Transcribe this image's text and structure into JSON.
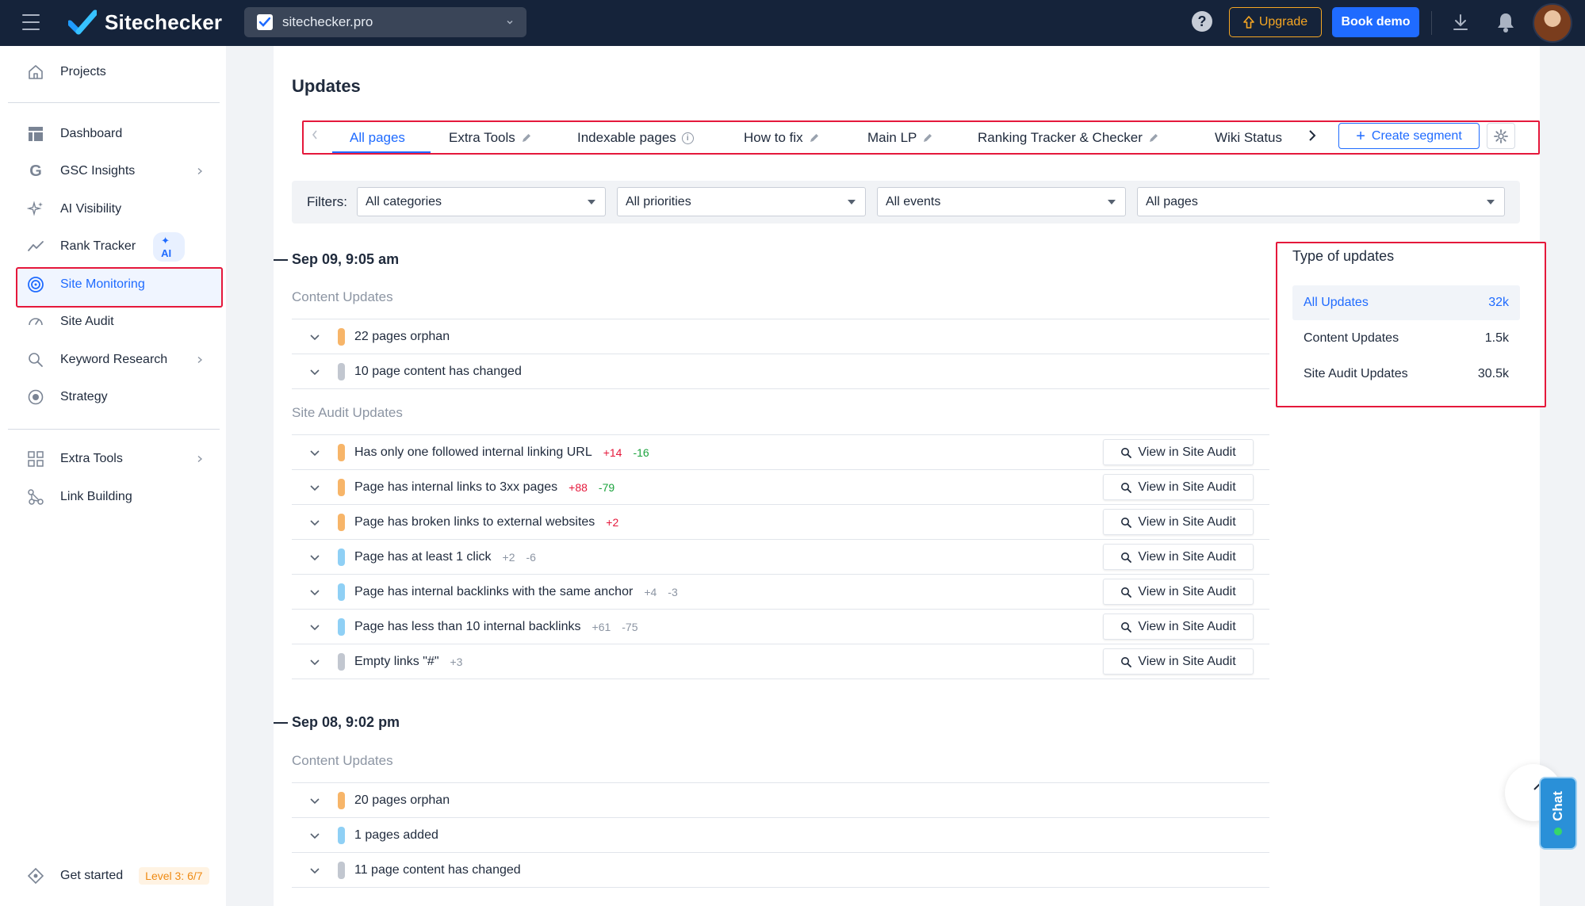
{
  "app": {
    "name": "Sitechecker",
    "site": "sitechecker.pro"
  },
  "topbar": {
    "help": "?",
    "upgrade_label": "Upgrade",
    "book_demo_label": "Book demo"
  },
  "sidebar": {
    "projects": "Projects",
    "items": [
      {
        "label": "Dashboard"
      },
      {
        "label": "GSC Insights"
      },
      {
        "label": "AI Visibility"
      },
      {
        "label": "Rank Tracker",
        "badge": "AI"
      },
      {
        "label": "Site Monitoring"
      },
      {
        "label": "Site Audit"
      },
      {
        "label": "Keyword Research"
      },
      {
        "label": "Strategy"
      },
      {
        "label": "Extra Tools"
      },
      {
        "label": "Link Building"
      }
    ],
    "get_started": "Get started",
    "level": "Level 3: 6/7"
  },
  "page": {
    "title": "Updates"
  },
  "tabs": {
    "items": [
      "All pages",
      "Extra Tools",
      "Indexable pages",
      "How to fix",
      "Main LP",
      "Ranking Tracker & Checker",
      "Wiki Status"
    ],
    "create_segment": "Create segment"
  },
  "filters": {
    "label": "Filters:",
    "categories": "All categories",
    "priorities": "All priorities",
    "events": "All events",
    "pages": "All pages"
  },
  "groups": [
    {
      "date": "Sep 09, 9:05 am",
      "content_label": "Content Updates",
      "content_rows": [
        {
          "text": "22 pages orphan",
          "color": "#f7b569"
        },
        {
          "text": "10 page content has changed",
          "color": "#c2c7d0"
        }
      ],
      "audit_label": "Site Audit Updates",
      "audit_rows": [
        {
          "text": "Has only one followed internal linking URL",
          "color": "#f7b569",
          "plus": "+14",
          "minus": "-16",
          "plus_class": "red",
          "minus_class": "green"
        },
        {
          "text": "Page has internal links to 3xx pages",
          "color": "#f7b569",
          "plus": "+88",
          "minus": "-79",
          "plus_class": "red",
          "minus_class": "green"
        },
        {
          "text": "Page has broken links to external websites",
          "color": "#f7b569",
          "plus": "+2",
          "minus": "",
          "plus_class": "red",
          "minus_class": "green"
        },
        {
          "text": "Page has at least 1 click",
          "color": "#8fd0f5",
          "plus": "+2",
          "minus": "-6",
          "plus_class": "grey",
          "minus_class": "grey"
        },
        {
          "text": "Page has internal backlinks with the same anchor",
          "color": "#8fd0f5",
          "plus": "+4",
          "minus": "-3",
          "plus_class": "grey",
          "minus_class": "grey"
        },
        {
          "text": "Page has less than 10 internal backlinks",
          "color": "#8fd0f5",
          "plus": "+61",
          "minus": "-75",
          "plus_class": "grey",
          "minus_class": "grey"
        },
        {
          "text": "Empty links \"#\"",
          "color": "#c2c7d0",
          "plus": "+3",
          "minus": "",
          "plus_class": "grey",
          "minus_class": "grey"
        }
      ],
      "view_label": "View in Site Audit"
    },
    {
      "date": "Sep 08, 9:02 pm",
      "content_label": "Content Updates",
      "content_rows": [
        {
          "text": "20 pages orphan",
          "color": "#f7b569"
        },
        {
          "text": "1 pages added",
          "color": "#8fd0f5"
        },
        {
          "text": "11 page content has changed",
          "color": "#c2c7d0"
        }
      ]
    }
  ],
  "type_of_updates": {
    "title": "Type of updates",
    "rows": [
      {
        "label": "All Updates",
        "count": "32k"
      },
      {
        "label": "Content Updates",
        "count": "1.5k"
      },
      {
        "label": "Site Audit Updates",
        "count": "30.5k"
      }
    ]
  },
  "chat": {
    "label": "Chat"
  },
  "colors": {
    "accent": "#1f6bff",
    "topbar": "#15233a",
    "highlight": "#e5183b",
    "upgrade": "#f5a623"
  }
}
